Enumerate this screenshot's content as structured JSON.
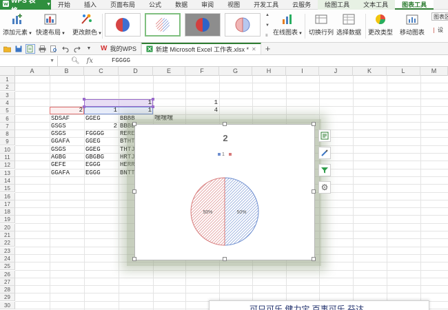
{
  "app": {
    "title": "WPS 表格"
  },
  "menu": {
    "tabs": [
      "开始",
      "插入",
      "页面布局",
      "公式",
      "数据",
      "审阅",
      "视图",
      "开发工具",
      "云服务",
      "绘图工具",
      "文本工具",
      "图表工具"
    ],
    "active": "图表工具"
  },
  "ribbon": {
    "add_element": "添加元素",
    "quick_layout": "快速布局",
    "change_color": "更改颜色",
    "online_chart": "在线图表",
    "switch_row_col": "切换行列",
    "select_data": "选择数据",
    "change_type": "更改类型",
    "move_chart": "移动图表",
    "chart_area": "图表区",
    "settings": "设"
  },
  "tabs": {
    "docs": [
      "我的WPS",
      "新建 Microsoft Excel 工作表.xlsx *"
    ]
  },
  "formula": {
    "namebox": "",
    "value": "FGGGG"
  },
  "columns": [
    "A",
    "B",
    "C",
    "D",
    "E",
    "F",
    "G",
    "H",
    "I",
    "J",
    "K",
    "L",
    "M"
  ],
  "rows": [
    "1",
    "2",
    "3",
    "4",
    "5",
    "6",
    "7",
    "8",
    "9",
    "10",
    "11",
    "12",
    "13",
    "14",
    "15",
    "16",
    "17",
    "18",
    "19",
    "20",
    "21",
    "22",
    "23",
    "24",
    "25",
    "26",
    "27",
    "28",
    "29",
    "30"
  ],
  "cells": {
    "D4": "1",
    "F4": "1",
    "B5": "2",
    "C5": "1",
    "D5": "1",
    "F5": "4",
    "B6": "SDSAF",
    "C6": "GGEG",
    "D6": "BBBB",
    "E6": "嘿嘿嘿",
    "B7": "GSGS",
    "C7": "2",
    "D7": "BBBB",
    "B8": "GSGS",
    "C8": "FGGGG",
    "D8": "RERE",
    "B9": "GGAFA",
    "C9": "GGEG",
    "D9": "BTHTH",
    "B10": "GSGS",
    "C10": "GGEG",
    "D10": "THTJ",
    "B11": "AGBG",
    "C11": "GBGBG",
    "D11": "HRTJ",
    "B12": "GEFE",
    "C12": "EGGG",
    "D12": "HERR",
    "B13": "GGAFA",
    "C13": "EGGG",
    "D13": "BNTT"
  },
  "chart_data": {
    "type": "pie",
    "title": "2",
    "legend": {
      "position": "top",
      "entries": [
        "1",
        ""
      ]
    },
    "categories": [
      "1",
      ""
    ],
    "values": [
      50,
      50
    ],
    "labels": [
      "50%",
      "50%"
    ],
    "colors": [
      "#6f8fd0",
      "#d77b7b"
    ]
  },
  "bottom_panel": {
    "text": "可只可乐 健力宝 百事可乐 芬达"
  },
  "colors": {
    "accent": "#2e7d32",
    "app": "#2f8f3e"
  }
}
